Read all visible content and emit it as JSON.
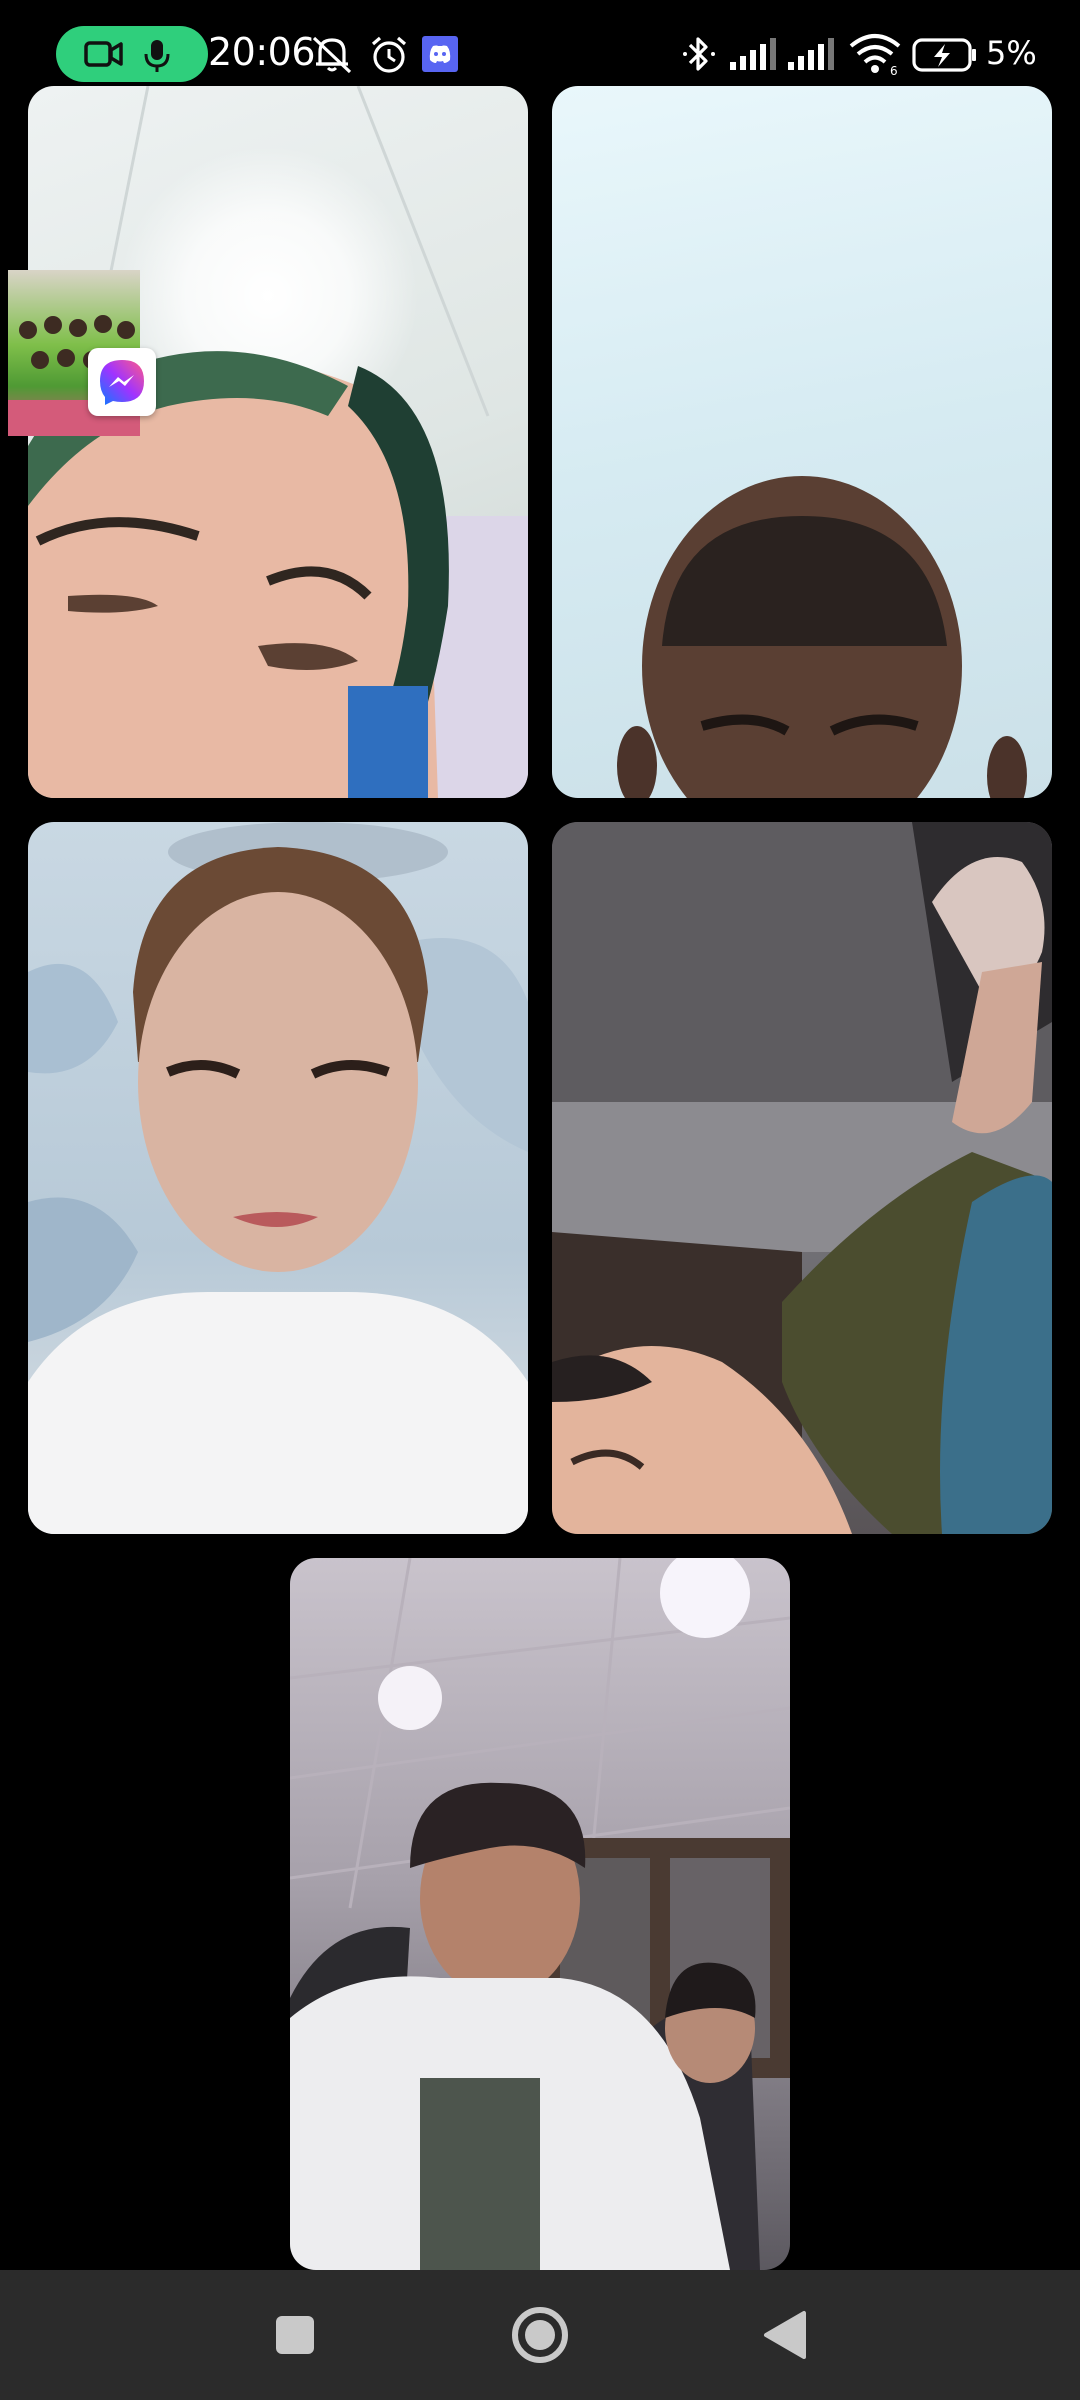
{
  "status_bar": {
    "time": "20:06",
    "battery_percent": "5%",
    "signal_bars": [
      4,
      4
    ],
    "wifi_badge": "6",
    "icons": [
      "video-call-icon",
      "microphone-icon",
      "silent-bell-icon",
      "alarm-icon",
      "discord-icon",
      "bluetooth-icon",
      "signal-icon",
      "wifi-icon",
      "battery-charging-icon"
    ],
    "call_pill_color": "#2fcf7c"
  },
  "call": {
    "participants": 5,
    "overlay_app": "messenger-icon"
  },
  "nav_bar": {
    "buttons": [
      "recents-button",
      "home-button",
      "back-button"
    ],
    "background": "#2b2b2b"
  }
}
